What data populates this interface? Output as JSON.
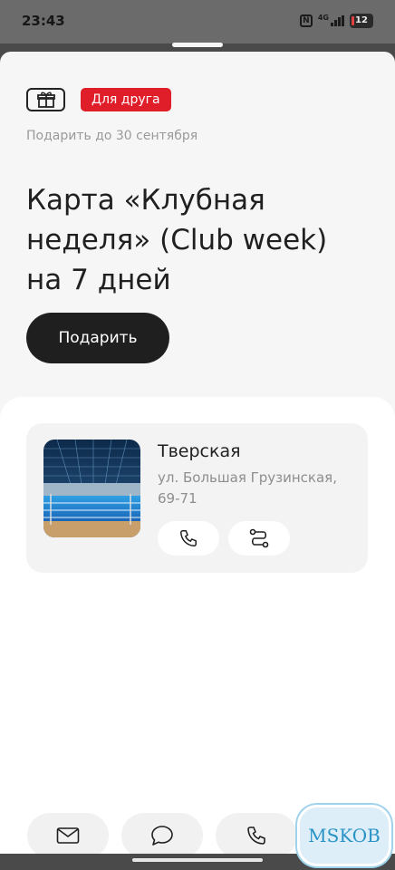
{
  "status_bar": {
    "time": "23:43",
    "network": "4G",
    "battery": "12"
  },
  "badges": {
    "gift_icon": "gift-icon",
    "friend_label": "Для друга"
  },
  "offer": {
    "deadline": "Подарить до 30 сентября",
    "title": "Карта «Клубная неделя» (Club week) на 7 дней",
    "gift_button_label": "Подарить"
  },
  "club": {
    "name": "Тверская",
    "address": "ул. Большая Грузинская, 69-71",
    "photo": "pool-photo",
    "actions": [
      "phone-icon",
      "route-icon"
    ]
  },
  "bottom_actions": [
    "mail-icon",
    "chat-icon",
    "phone-icon"
  ],
  "watermark": "MSKOB",
  "colors": {
    "accent_red": "#e01e2a",
    "dark_button": "#1f1f1f",
    "watermark_blue": "#2a93c6"
  }
}
